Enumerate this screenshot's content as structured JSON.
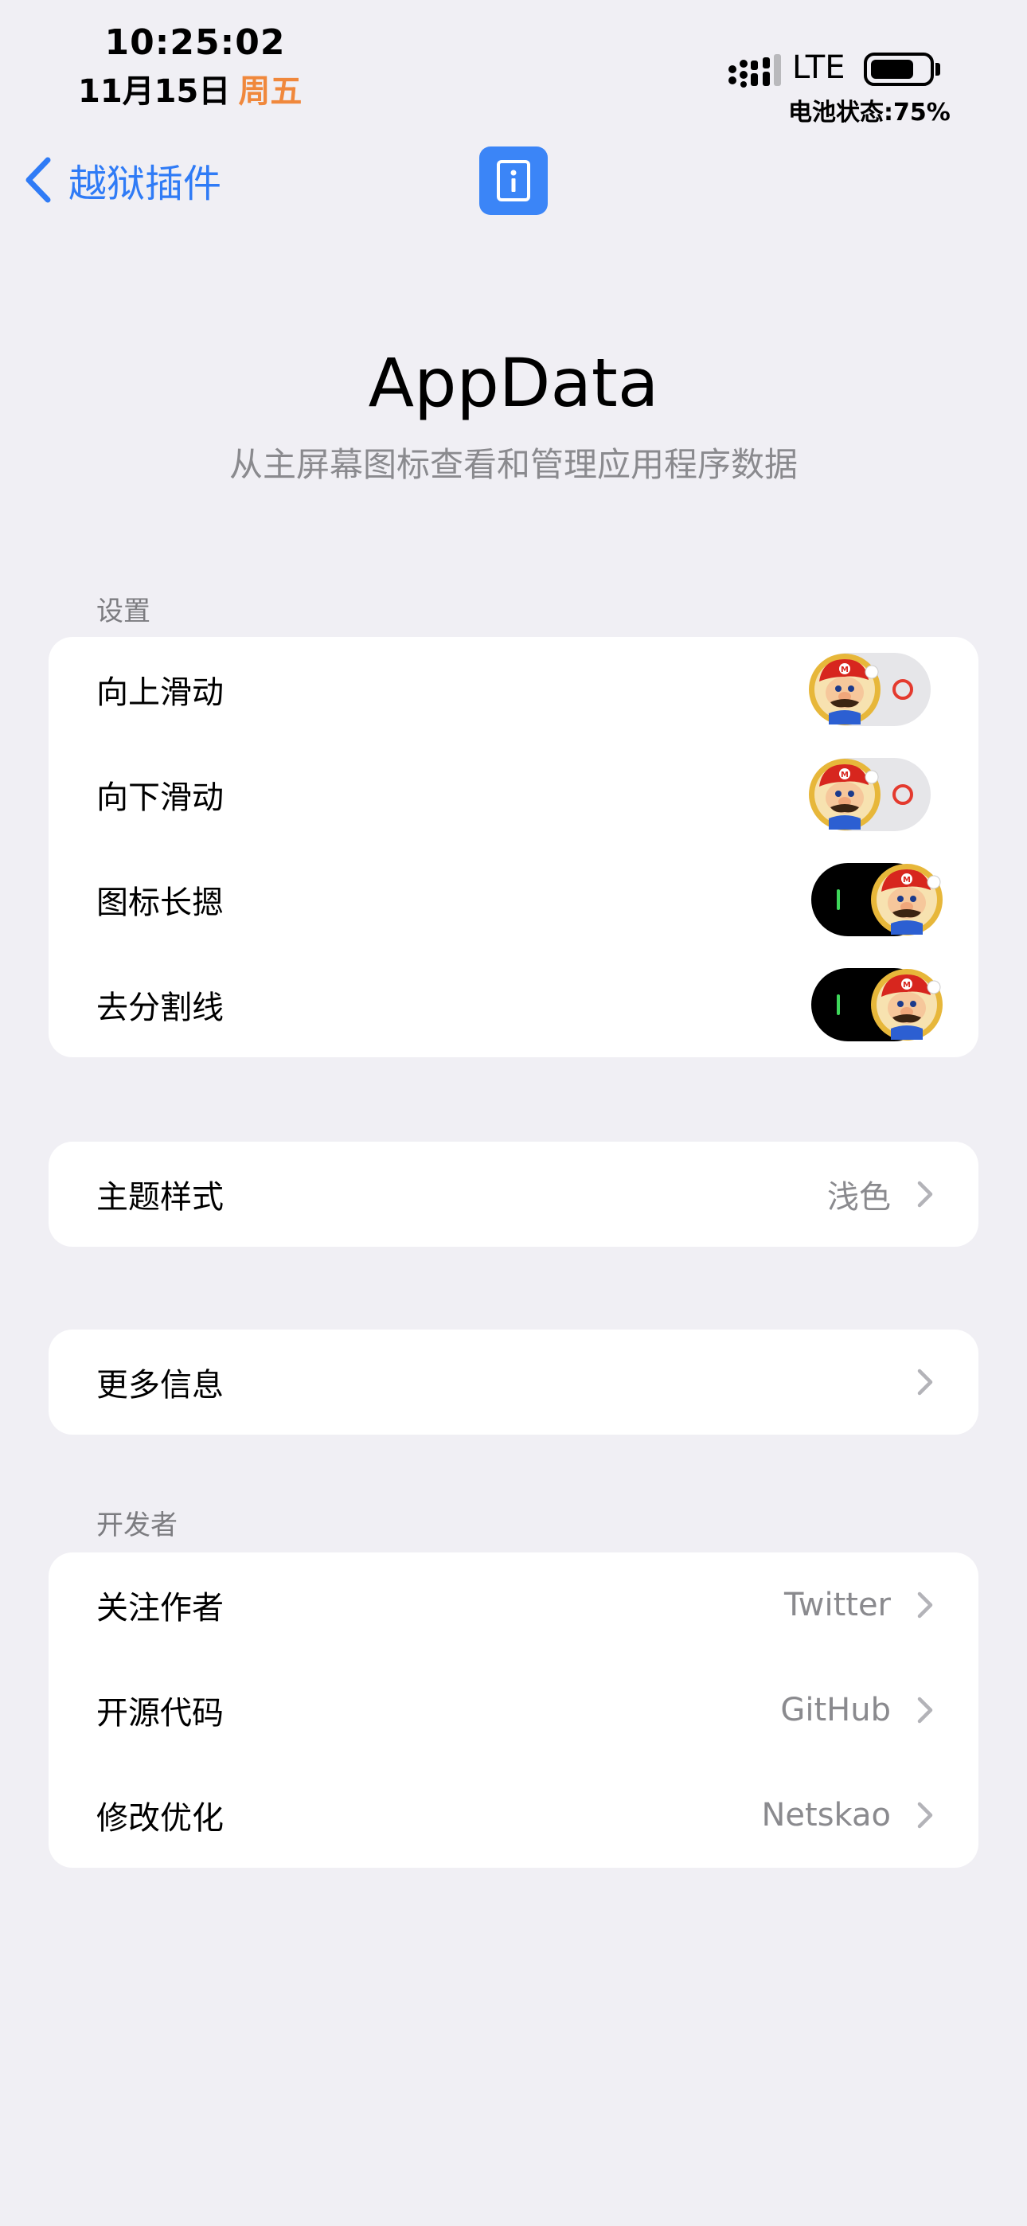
{
  "status_bar": {
    "time": "10:25:02",
    "date": "11月15日",
    "weekday": "周五",
    "network": "LTE",
    "battery_text": "电池状态:75%",
    "battery_level": 0.75
  },
  "nav": {
    "back_label": "越狱插件"
  },
  "header": {
    "title": "AppData",
    "subtitle": "从主屏幕图标查看和管理应用程序数据"
  },
  "settings": {
    "header": "设置",
    "items": [
      {
        "label": "向上滑动",
        "on": false
      },
      {
        "label": "向下滑动",
        "on": false
      },
      {
        "label": "图标长摁",
        "on": true
      },
      {
        "label": "去分割线",
        "on": true
      }
    ]
  },
  "theme": {
    "label": "主题样式",
    "value": "浅色"
  },
  "more": {
    "label": "更多信息"
  },
  "developer": {
    "header": "开发者",
    "items": [
      {
        "label": "关注作者",
        "value": "Twitter"
      },
      {
        "label": "开源代码",
        "value": "GitHub"
      },
      {
        "label": "修改优化",
        "value": "Netskao"
      }
    ]
  },
  "colors": {
    "accent": "#2f7bf6",
    "background": "#f0eff4",
    "switch_on": "#000000",
    "switch_off": "#e6e6e9"
  }
}
